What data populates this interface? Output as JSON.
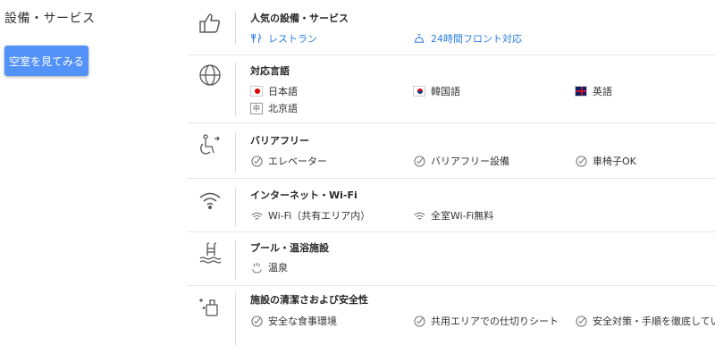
{
  "sidebar": {
    "title": "設備・サービス",
    "cta_label": "空室を見てみる"
  },
  "sections": {
    "popular": {
      "title": "人気の設備・サービス",
      "items": [
        "レストラン",
        "24時間フロント対応"
      ]
    },
    "languages": {
      "title": "対応言語",
      "items": [
        "日本語",
        "韓国語",
        "英語",
        "北京語"
      ]
    },
    "barrier_free": {
      "title": "バリアフリー",
      "items": [
        "エレベーター",
        "バリアフリー設備",
        "車椅子OK"
      ]
    },
    "internet": {
      "title": "インターネット・Wi-Fi",
      "items": [
        "Wi-Fi（共有エリア内）",
        "全室Wi-Fi無料"
      ]
    },
    "pool": {
      "title": "プール・温浴施設",
      "items": [
        "温泉"
      ]
    },
    "hygiene": {
      "title": "施設の清潔さおよび安全性",
      "items": [
        "安全な食事環境",
        "共用エリアでの仕切りシート",
        "安全対策・手順を徹底しています"
      ]
    }
  },
  "colors": {
    "accent": "#5392f9",
    "link": "#2a7de1",
    "icon": "#555555"
  },
  "icons": [
    "thumbs-up-icon",
    "globe-icon",
    "accessibility-icon",
    "wifi-icon",
    "pool-icon",
    "cleaning-icon",
    "restaurant-icon",
    "front-desk-icon",
    "check-circle-icon",
    "onsen-icon"
  ]
}
